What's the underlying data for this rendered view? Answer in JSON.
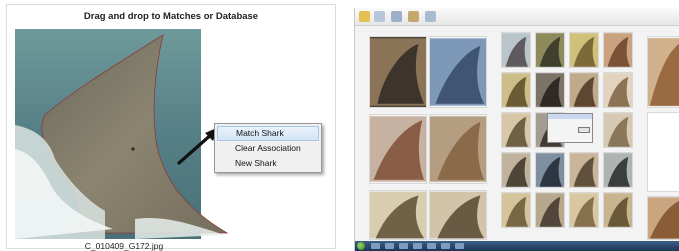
{
  "left": {
    "title": "Drag and drop to Matches or Database",
    "filename": "C_010409_G172.jpg",
    "context_menu": {
      "items": [
        {
          "label": "Match Shark",
          "highlighted": true
        },
        {
          "label": "Clear Association",
          "highlighted": false
        },
        {
          "label": "New Shark",
          "highlighted": false
        }
      ]
    }
  },
  "right": {
    "left_pane_label": "",
    "middle_pane_label": "",
    "toolbar_buttons": [
      "toolbar-button-1",
      "toolbar-button-2",
      "toolbar-button-3",
      "toolbar-button-4",
      "toolbar-button-5"
    ]
  },
  "colors": {
    "ocean": "#5d8a8e",
    "fin": "#857d6a",
    "highlight": "#d4e4f6",
    "taskbar": "#1d3554"
  }
}
